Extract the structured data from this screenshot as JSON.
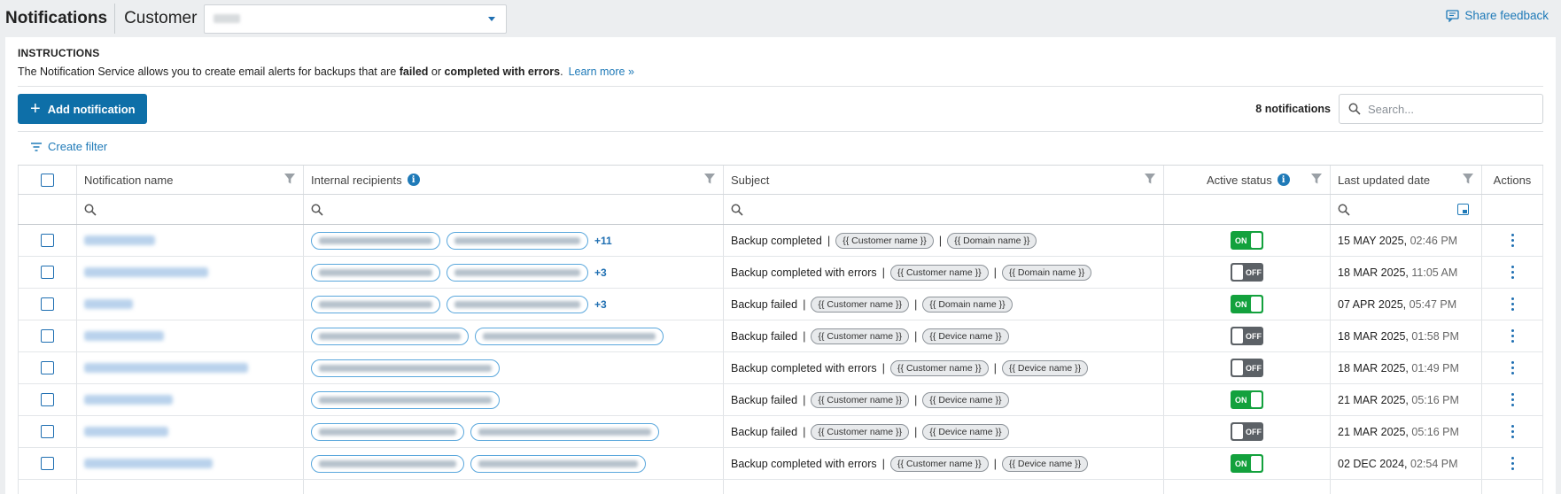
{
  "header": {
    "title": "Notifications",
    "customer_label": "Customer",
    "share_feedback": "Share feedback"
  },
  "instructions": {
    "title": "INSTRUCTIONS",
    "text_before": "The Notification Service allows you to create email alerts for backups that are ",
    "failed": "failed",
    "or": " or ",
    "completed_with_errors": "completed with errors",
    "period": ".",
    "learn_more": "Learn more »"
  },
  "toolbar": {
    "add_label": "Add notification",
    "count": "8 notifications",
    "search_placeholder": "Search...",
    "create_filter": "Create filter"
  },
  "table": {
    "headers": {
      "name": "Notification name",
      "recipients": "Internal recipients",
      "subject": "Subject",
      "status": "Active status",
      "date": "Last updated date",
      "actions": "Actions"
    },
    "rows": [
      {
        "name_w": 80,
        "recipients": [
          128,
          142
        ],
        "more": "+11",
        "subject": "Backup completed",
        "tags": [
          "{{ Customer name }}",
          "{{ Domain name }}"
        ],
        "active": true,
        "status_label": "ON",
        "date": "15 MAY 2025,",
        "time": "02:46 PM"
      },
      {
        "name_w": 140,
        "recipients": [
          128,
          142
        ],
        "more": "+3",
        "subject": "Backup completed with errors",
        "tags": [
          "{{ Customer name }}",
          "{{ Domain name }}"
        ],
        "active": false,
        "status_label": "OFF",
        "date": "18 MAR 2025,",
        "time": "11:05 AM"
      },
      {
        "name_w": 55,
        "recipients": [
          128,
          142
        ],
        "more": "+3",
        "subject": "Backup failed",
        "tags": [
          "{{ Customer name }}",
          "{{ Domain name }}"
        ],
        "active": true,
        "status_label": "ON",
        "date": "07 APR 2025,",
        "time": "05:47 PM"
      },
      {
        "name_w": 90,
        "recipients": [
          160,
          195
        ],
        "more": "",
        "subject": "Backup failed",
        "tags": [
          "{{ Customer name }}",
          "{{ Device name }}"
        ],
        "active": false,
        "status_label": "OFF",
        "date": "18 MAR 2025,",
        "time": "01:58 PM"
      },
      {
        "name_w": 185,
        "recipients": [
          195
        ],
        "more": "",
        "subject": "Backup completed with errors",
        "tags": [
          "{{ Customer name }}",
          "{{ Device name }}"
        ],
        "active": false,
        "status_label": "OFF",
        "date": "18 MAR 2025,",
        "time": "01:49 PM"
      },
      {
        "name_w": 100,
        "recipients": [
          195
        ],
        "more": "",
        "subject": "Backup failed",
        "tags": [
          "{{ Customer name }}",
          "{{ Device name }}"
        ],
        "active": true,
        "status_label": "ON",
        "date": "21 MAR 2025,",
        "time": "05:16 PM"
      },
      {
        "name_w": 95,
        "recipients": [
          155,
          195
        ],
        "more": "",
        "subject": "Backup failed",
        "tags": [
          "{{ Customer name }}",
          "{{ Device name }}"
        ],
        "active": false,
        "status_label": "OFF",
        "date": "21 MAR 2025,",
        "time": "05:16 PM"
      },
      {
        "name_w": 145,
        "recipients": [
          155,
          180
        ],
        "more": "",
        "subject": "Backup completed with errors",
        "tags": [
          "{{ Customer name }}",
          "{{ Device name }}"
        ],
        "active": true,
        "status_label": "ON",
        "date": "02 DEC 2024,",
        "time": "02:54 PM"
      }
    ]
  },
  "colors": {
    "accent": "#1f7ab8",
    "primary_button": "#0e6fa8",
    "on": "#13a13d",
    "off": "#5c6166"
  },
  "icons": [
    "feedback-icon",
    "plus-icon",
    "search-icon",
    "filter-lines-icon",
    "funnel-icon",
    "info-icon",
    "calendar-icon",
    "kebab-icon",
    "chevron-down-icon"
  ]
}
